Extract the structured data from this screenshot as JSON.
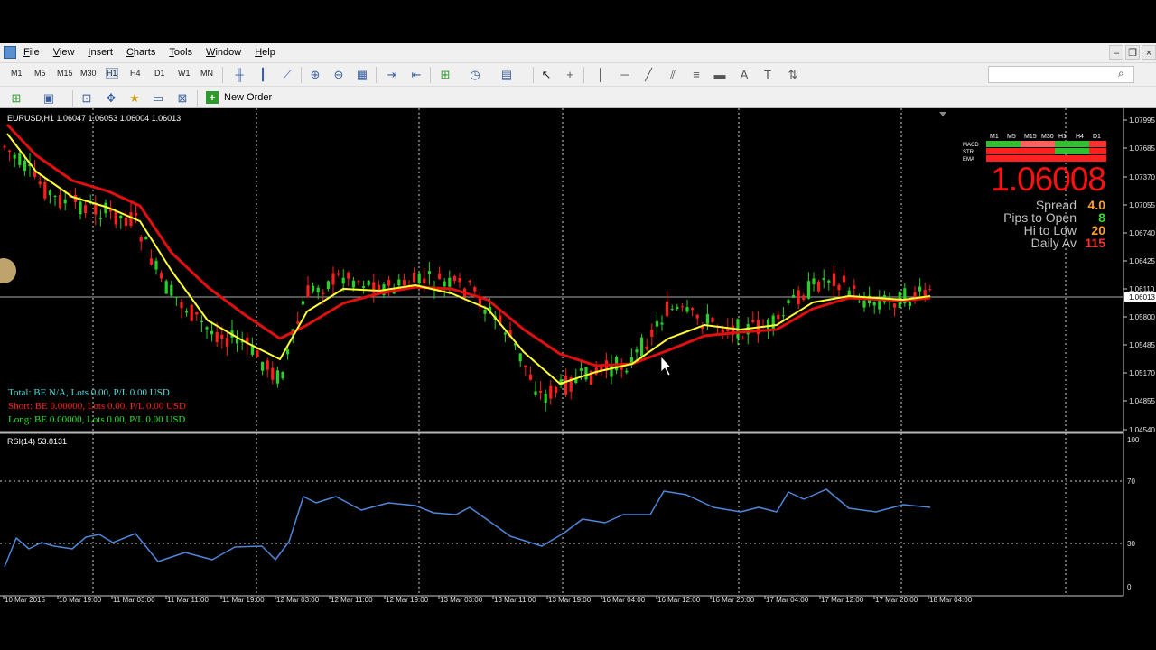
{
  "menu": {
    "items": [
      "File",
      "View",
      "Insert",
      "Charts",
      "Tools",
      "Window",
      "Help"
    ]
  },
  "toolbar": {
    "timeframes": [
      "M1",
      "M5",
      "M15",
      "M30",
      "H1",
      "H4",
      "D1",
      "W1",
      "MN"
    ],
    "new_order_label": "New Order"
  },
  "chart": {
    "header": "EURUSD,H1  1.06047 1.06053 1.06004 1.06013",
    "price_axis_labels": [
      "1.07995",
      "1.07685",
      "1.07370",
      "1.07055",
      "1.06740",
      "1.06425",
      "1.06110",
      "1.05800",
      "1.05485",
      "1.05170",
      "1.04855",
      "1.04540"
    ],
    "current_price_label": "1.06013",
    "rsi_header": "RSI(14) 53.8131",
    "rsi_axis_labels": [
      "100",
      "70",
      "30",
      "0"
    ],
    "time_labels": [
      "10 Mar 2015",
      "10 Mar 19:00",
      "11 Mar 03:00",
      "11 Mar 11:00",
      "11 Mar 19:00",
      "12 Mar 03:00",
      "12 Mar 11:00",
      "12 Mar 19:00",
      "13 Mar 03:00",
      "13 Mar 11:00",
      "13 Mar 19:00",
      "16 Mar 04:00",
      "16 Mar 12:00",
      "16 Mar 20:00",
      "17 Mar 04:00",
      "17 Mar 12:00",
      "17 Mar 20:00",
      "18 Mar 04:00"
    ],
    "colors": {
      "ema_fast": "#ffff33",
      "ema_slow": "#e01010",
      "rsi": "#4f86d8",
      "bull": "#2ad02a",
      "bear": "#ff1e1e"
    }
  },
  "positions": {
    "total": "Total: BE N/A, Lots 0.00,  P/L 0.00 USD",
    "short": "Short: BE 0.00000, Lots 0.00,  P/L 0.00 USD",
    "long": "Long: BE 0.00000, Lots 0.00,  P/L 0.00 USD"
  },
  "dashboard": {
    "timeframes": [
      "M1",
      "M5",
      "M15",
      "M30",
      "H1",
      "H4",
      "D1"
    ],
    "rows": [
      "MACD",
      "STR",
      "EMA"
    ],
    "price": "1.06008",
    "stats": [
      {
        "label": "Spread",
        "value": "4.0",
        "color": "#ffa020"
      },
      {
        "label": "Pips to Open",
        "value": "8",
        "color": "#30e030"
      },
      {
        "label": "Hi to Low",
        "value": "20",
        "color": "#ffa020"
      },
      {
        "label": "Daily Av",
        "value": "115",
        "color": "#ff3030"
      }
    ]
  }
}
